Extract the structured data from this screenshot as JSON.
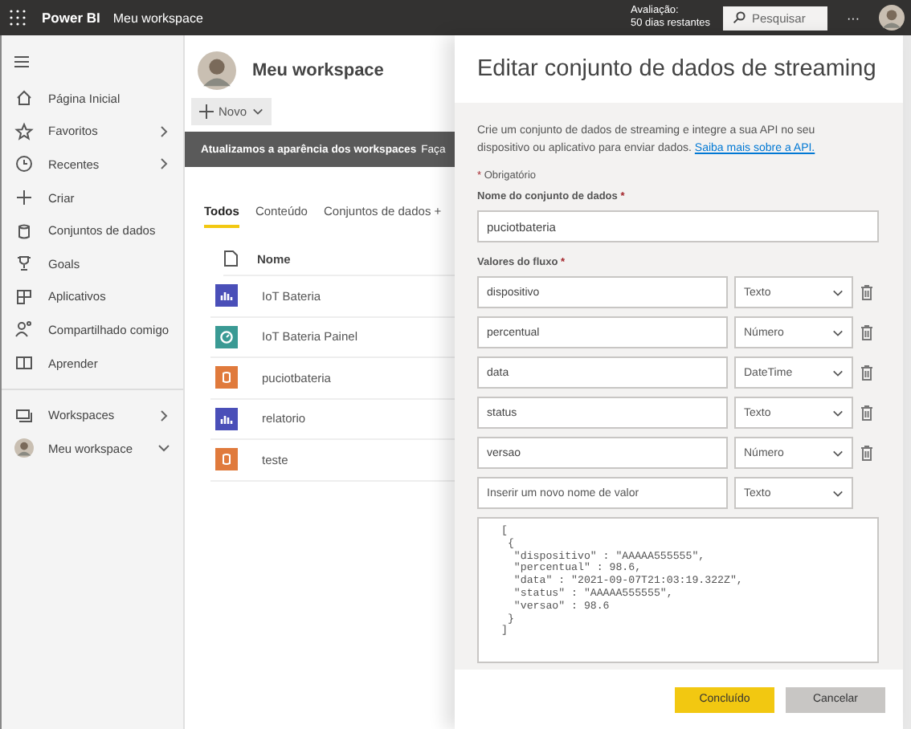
{
  "top_bar": {
    "app_name": "Power BI",
    "breadcrumb": "Meu workspace",
    "trial": [
      "Avaliação:",
      "50 dias restantes"
    ],
    "search": {
      "placeholder": "Pesquisar"
    },
    "more": "···"
  },
  "sidebar": {
    "items": [
      {
        "label": "Página Inicial"
      },
      {
        "label": "Favoritos",
        "expanded": false
      },
      {
        "label": "Recentes",
        "expanded": false
      },
      {
        "label": "Criar"
      },
      {
        "label": "Conjuntos de dados"
      },
      {
        "label": "Goals"
      },
      {
        "label": "Aplicativos"
      },
      {
        "label": "Compartilhado comigo"
      },
      {
        "label": "Aprender"
      }
    ],
    "bottom_items": [
      {
        "label": "Workspaces",
        "expanded": false
      },
      {
        "label": "Meu workspace",
        "expanded": true
      }
    ]
  },
  "workspace": {
    "title": "Meu workspace",
    "new_button": "Novo",
    "banner": {
      "bold": "Atualizamos a aparência dos workspaces",
      "text": "Faça"
    },
    "tabs": [
      {
        "label": "Todos",
        "selected": true
      },
      {
        "label": "Conteúdo",
        "selected": false
      },
      {
        "label": "Conjuntos de dados +",
        "selected": false
      }
    ],
    "table": {
      "columns": [
        "Nome"
      ],
      "rows": [
        {
          "kind": "report",
          "name": "IoT Bateria"
        },
        {
          "kind": "dashboard",
          "name": "IoT Bateria Painel"
        },
        {
          "kind": "dataset",
          "name": "puciotbateria"
        },
        {
          "kind": "report",
          "name": "relatorio"
        },
        {
          "kind": "dataset",
          "name": "teste"
        }
      ]
    }
  },
  "panel": {
    "title": "Editar conjunto de dados de streaming",
    "description": "Crie um conjunto de dados de streaming e integre a sua API no seu dispositivo ou aplicativo para enviar dados.",
    "link": "Saiba mais sobre a API.",
    "required_mark": "*",
    "required_note": "Obrigatório",
    "name_label": "Nome do conjunto de dados",
    "name_value": "puciotbateria",
    "values_label": "Valores do fluxo",
    "values": [
      {
        "name": "dispositivo",
        "type": "Texto",
        "removable": true
      },
      {
        "name": "percentual",
        "type": "Número",
        "removable": true
      },
      {
        "name": "data",
        "type": "DateTime",
        "removable": true
      },
      {
        "name": "status",
        "type": "Texto",
        "removable": true
      },
      {
        "name": "versao",
        "type": "Número",
        "removable": true
      },
      {
        "placeholder": "Inserir um novo nome de valor",
        "type": "Texto",
        "removable": false
      }
    ],
    "sample_json": "[\n {\n  \"dispositivo\" : \"AAAAA555555\",\n  \"percentual\" : 98.6,\n  \"data\" : \"2021-09-07T21:03:19.322Z\",\n  \"status\" : \"AAAAA555555\",\n  \"versao\" : 98.6\n }\n]",
    "buttons": [
      {
        "kind": "primary",
        "label": "Concluído"
      },
      {
        "kind": "secondary",
        "label": "Cancelar"
      }
    ]
  }
}
